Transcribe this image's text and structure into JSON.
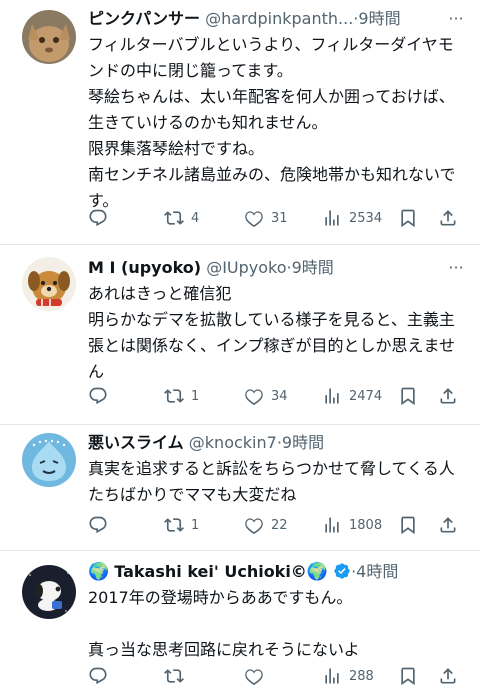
{
  "posts": [
    {
      "name": "ピンクパンサー",
      "handle": "@hardpinkpanth...",
      "time": "9時間",
      "text": "フィルターバブルというより、フィルターダイヤモンドの中に閉じ籠ってます。\n琴絵ちゃんは、太い年配客を何人か囲っておけば、生きていけるのかも知れません。\n限界集落琴絵村ですね。\n南センチネル諸島並みの、危険地帯かも知れないです。",
      "replies": "",
      "reposts": "4",
      "likes": "31",
      "views": "2534"
    },
    {
      "name": "M I (upyoko)",
      "handle": "@IUpyoko",
      "time": "9時間",
      "text": "あれはきっと確信犯\n明らかなデマを拡散している様子を見ると、主義主張とは関係なく、インプ稼ぎが目的としか思えません",
      "replies": "",
      "reposts": "1",
      "likes": "34",
      "views": "2474"
    },
    {
      "name": "悪いスライム",
      "handle": "@knockin7",
      "time": "9時間",
      "text": "真実を追求すると訴訟をちらつかせて脅してくる人たちばかりでママも大変だね",
      "replies": "",
      "reposts": "1",
      "likes": "22",
      "views": "1808"
    },
    {
      "name_prefix": "🌍",
      "name": "Takashi kei' Uchioki©",
      "name_suffix": "🌍",
      "handle": "",
      "time": "4時間",
      "text": "2017年の登場時からああですもん。\n\n真っ当な思考回路に戻れそうにないよ",
      "replies": "",
      "reposts": "",
      "likes": "",
      "views": "288"
    }
  ],
  "dot": "·",
  "more_glyph": "···",
  "colors": {
    "text": "#0f1419",
    "secondary": "#536471",
    "divider": "#e3e7ea",
    "verified": "#1d9bf0"
  },
  "icons": [
    "reply-icon",
    "repost-icon",
    "like-icon",
    "views-icon",
    "bookmark-icon",
    "share-icon",
    "more-icon",
    "verified-icon"
  ]
}
